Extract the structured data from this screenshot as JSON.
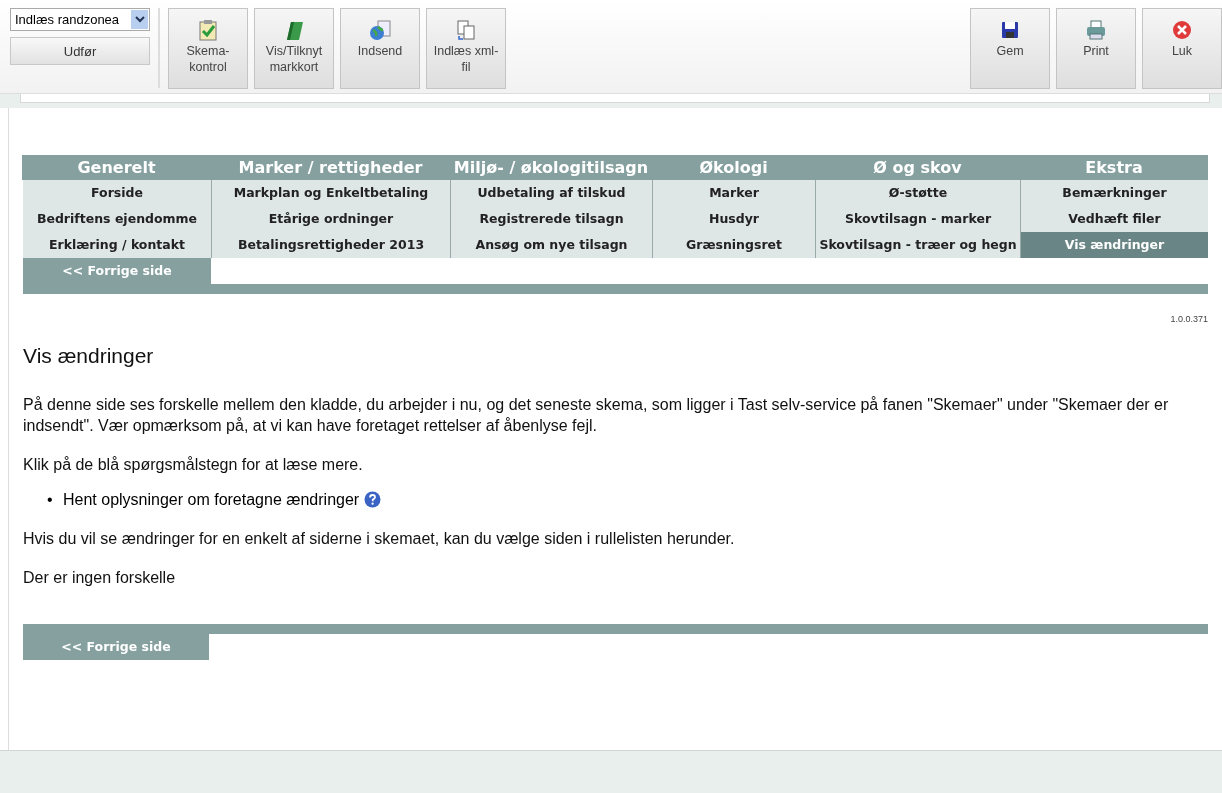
{
  "toolbar": {
    "select_value": "Indlæs randzonea",
    "run_button": "Udfør",
    "tools": [
      {
        "kind": "clipboard",
        "label": "Skema-\nkontrol"
      },
      {
        "kind": "map",
        "label": "Vis/Tilknyt\nmarkkort"
      },
      {
        "kind": "globe",
        "label": "Indsend"
      },
      {
        "kind": "files",
        "label": "Indlæs xml-\nfil"
      }
    ],
    "right_tools": [
      {
        "kind": "save",
        "label": "Gem"
      },
      {
        "kind": "print",
        "label": "Print"
      },
      {
        "kind": "close",
        "label": "Luk"
      }
    ]
  },
  "nav": {
    "columns": [
      {
        "heading": "Generelt",
        "items": [
          {
            "label": "Forside",
            "selected": false
          },
          {
            "label": "Bedriftens ejendomme",
            "selected": false
          },
          {
            "label": "Erklæring / kontakt",
            "selected": false
          }
        ]
      },
      {
        "heading": "Marker / rettigheder",
        "items": [
          {
            "label": "Markplan og Enkeltbetaling",
            "selected": false
          },
          {
            "label": "Etårige ordninger",
            "selected": false
          },
          {
            "label": "Betalingsrettigheder 2013",
            "selected": false
          }
        ]
      },
      {
        "heading": "Miljø- / økologitilsagn",
        "items": [
          {
            "label": "Udbetaling af tilskud",
            "selected": false
          },
          {
            "label": "Registrerede tilsagn",
            "selected": false
          },
          {
            "label": "Ansøg om nye tilsagn",
            "selected": false
          }
        ]
      },
      {
        "heading": "Økologi",
        "items": [
          {
            "label": "Marker",
            "selected": false
          },
          {
            "label": "Husdyr",
            "selected": false
          },
          {
            "label": "Græsningsret",
            "selected": false
          }
        ]
      },
      {
        "heading": "Ø og skov",
        "items": [
          {
            "label": "Ø-støtte",
            "selected": false
          },
          {
            "label": "Skovtilsagn - marker",
            "selected": false
          },
          {
            "label": "Skovtilsagn - træer og hegn",
            "selected": false
          }
        ]
      },
      {
        "heading": "Ekstra",
        "items": [
          {
            "label": "Bemærkninger",
            "selected": false
          },
          {
            "label": "Vedhæft filer",
            "selected": false
          },
          {
            "label": "Vis ændringer",
            "selected": true
          }
        ]
      }
    ],
    "prev_button": "<< Forrige side"
  },
  "version": "1.0.0.371",
  "content": {
    "title": "Vis ændringer",
    "intro": "På denne side ses forskelle mellem den kladde, du arbejder i nu, og det seneste skema, som ligger i Tast selv-service på fanen \"Skemaer\" under \"Skemaer der er indsendt\". Vær opmærksom på, at vi kan have foretaget rettelser af åbenlyse fejl.",
    "hint": "Klik på de blå spørgsmålstegn for at læse mere.",
    "bullets": [
      {
        "marker": "•",
        "text": "Hent oplysninger om foretagne ændringer"
      }
    ],
    "select_hint": "Hvis du vil se ændringer for en enkelt af siderne i skemaet, kan du vælge siden i rullelisten herunder.",
    "result": "Der er ingen forskelle"
  },
  "bottom_prev_button": "<< Forrige side"
}
